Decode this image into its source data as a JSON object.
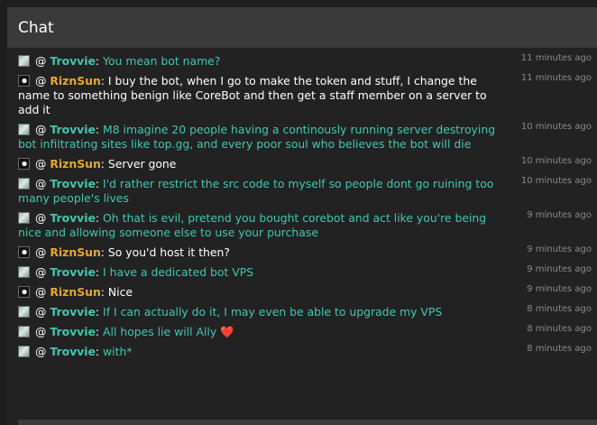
{
  "header": {
    "title": "Chat"
  },
  "messages": [
    {
      "user": "Trovvie",
      "avatar": "trovvie-avatar",
      "text": "You mean bot name?",
      "time": "11 minutes ago"
    },
    {
      "user": "RiznSun",
      "avatar": "riznsun-avatar",
      "text": "I buy the bot, when I go to make the token and stuff, I change the name to something benign like CoreBot and then get a staff member on a server to add it",
      "time": "11 minutes ago"
    },
    {
      "user": "Trovvie",
      "avatar": "trovvie-avatar",
      "text": "M8 imagine 20 people having a continously running server destroying bot infiltrating sites like top.gg, and every poor soul who believes the bot will die",
      "time": "10 minutes ago"
    },
    {
      "user": "RiznSun",
      "avatar": "riznsun-avatar",
      "text": "Server gone",
      "time": "10 minutes ago"
    },
    {
      "user": "Trovvie",
      "avatar": "trovvie-avatar",
      "text": "I'd rather restrict the src code to myself so people dont go ruining too many people's lives",
      "time": "10 minutes ago"
    },
    {
      "user": "Trovvie",
      "avatar": "trovvie-avatar",
      "text": "Oh that is evil, pretend you bought corebot and act like you're being nice and allowing someone else to use your purchase",
      "time": "9 minutes ago"
    },
    {
      "user": "RiznSun",
      "avatar": "riznsun-avatar",
      "text": "So you'd host it then?",
      "time": "9 minutes ago"
    },
    {
      "user": "Trovvie",
      "avatar": "trovvie-avatar",
      "text": "I have a dedicated bot VPS",
      "time": "9 minutes ago"
    },
    {
      "user": "RiznSun",
      "avatar": "riznsun-avatar",
      "text": "Nice",
      "time": "9 minutes ago"
    },
    {
      "user": "Trovvie",
      "avatar": "trovvie-avatar",
      "text": "If I can actually do it, I may even be able to upgrade my VPS",
      "time": "8 minutes ago"
    },
    {
      "user": "Trovvie",
      "avatar": "trovvie-avatar",
      "text": "All hopes lie will Ally",
      "emoji": "❤️",
      "time": "8 minutes ago"
    },
    {
      "user": "Trovvie",
      "avatar": "trovvie-avatar",
      "text": "with*",
      "time": "8 minutes ago"
    }
  ],
  "mention_symbol": "@",
  "colors": {
    "trovvie": "#3ec8b2",
    "riznsun": "#e6a92c",
    "background": "#222222",
    "header": "#3a3a3a"
  }
}
